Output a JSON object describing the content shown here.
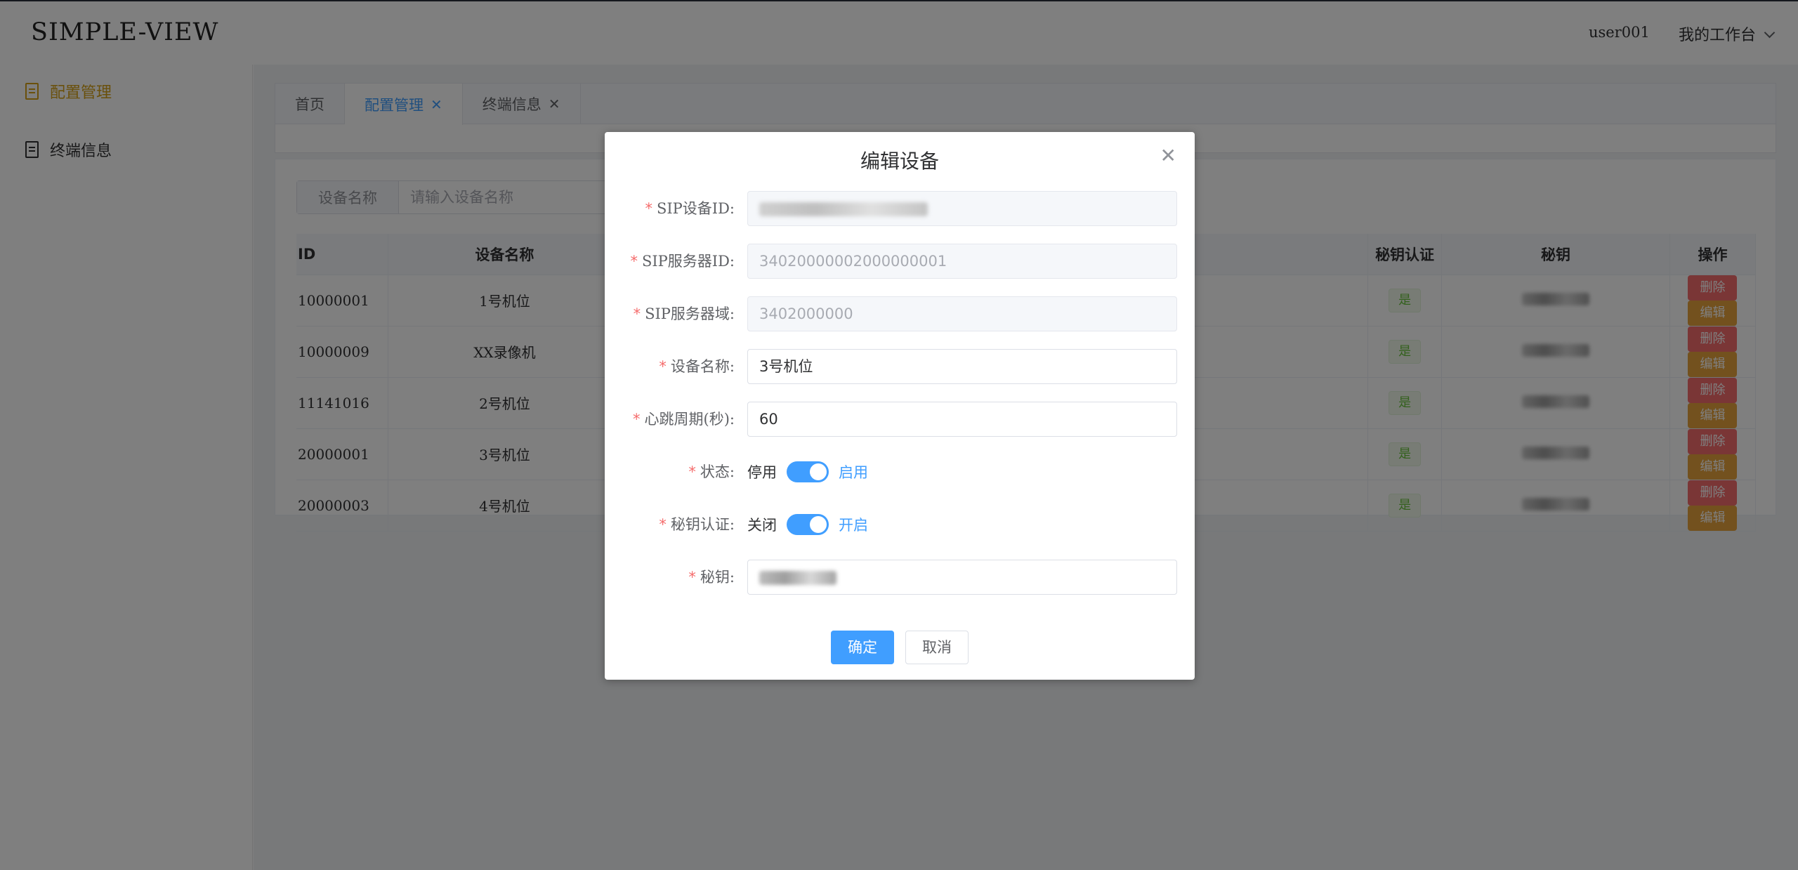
{
  "header": {
    "logo": "SIMPLE-VIEW",
    "user": "user001",
    "workbench": "我的工作台"
  },
  "sidebar": {
    "items": [
      {
        "label": "配置管理",
        "active": true
      },
      {
        "label": "终端信息",
        "active": false
      }
    ]
  },
  "tabs": [
    {
      "label": "首页"
    },
    {
      "label": "配置管理"
    },
    {
      "label": "终端信息"
    }
  ],
  "search": {
    "label": "设备名称",
    "placeholder": "请输入设备名称"
  },
  "table": {
    "headers": {
      "id": "ID",
      "name": "设备名称",
      "auth": "秘钥认证",
      "key": "秘钥",
      "ops": "操作"
    },
    "rows": [
      {
        "id": "10000001",
        "name": "1号机位",
        "auth": "是"
      },
      {
        "id": "10000009",
        "name": "XX录像机",
        "auth": "是"
      },
      {
        "id": "11141016",
        "name": "2号机位",
        "auth": "是"
      },
      {
        "id": "20000001",
        "name": "3号机位",
        "auth": "是"
      },
      {
        "id": "20000003",
        "name": "4号机位",
        "auth": "是"
      }
    ],
    "delete_label": "删除",
    "edit_label": "编辑"
  },
  "dialog": {
    "title": "编辑设备",
    "fields": {
      "sip_id": {
        "label": "SIP设备ID:"
      },
      "server_id": {
        "label": "SIP服务器ID:",
        "value": "34020000002000000001"
      },
      "server_domain": {
        "label": "SIP服务器域:",
        "value": "3402000000"
      },
      "device_name": {
        "label": "设备名称:",
        "value": "3号机位"
      },
      "heartbeat": {
        "label": "心跳周期(秒):",
        "value": "60"
      },
      "status": {
        "label": "状态:",
        "off": "停用",
        "on": "启用"
      },
      "auth": {
        "label": "秘钥认证:",
        "off": "关闭",
        "on": "开启"
      },
      "secret": {
        "label": "秘钥:"
      }
    },
    "confirm": "确定",
    "cancel": "取消"
  },
  "colors": {
    "primary": "#409eff",
    "danger": "#f56c6c",
    "warning": "#e6a23c",
    "success": "#67c23a",
    "active_menu": "#d4a017"
  }
}
